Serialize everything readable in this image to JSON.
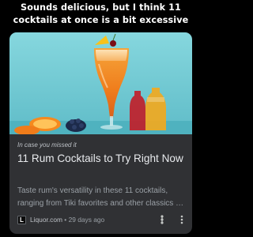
{
  "caption": {
    "line1": "Sounds delicious, but I think 11",
    "line2": "cocktails at once is a bit excessive"
  },
  "card": {
    "eyebrow": "In case you missed it",
    "title": "11 Rum Cocktails to Try Right Now",
    "snippet": "Taste rum's versatility in these 11 cocktails, ranging from Tiki favorites and other classics to modern creations.",
    "source": {
      "favicon_letter": "L",
      "name": "Liquor.com",
      "separator": " • ",
      "age": "29 days ago"
    },
    "actions": {
      "share_icon": "share-icon",
      "more_icon": "more-vert-icon"
    }
  },
  "colors": {
    "background": "#000000",
    "card": "#303134",
    "title": "#e8eaed",
    "secondary_text": "#9aa0a6",
    "image_backdrop": "#7fd1d9",
    "drink": "#f2871f"
  }
}
